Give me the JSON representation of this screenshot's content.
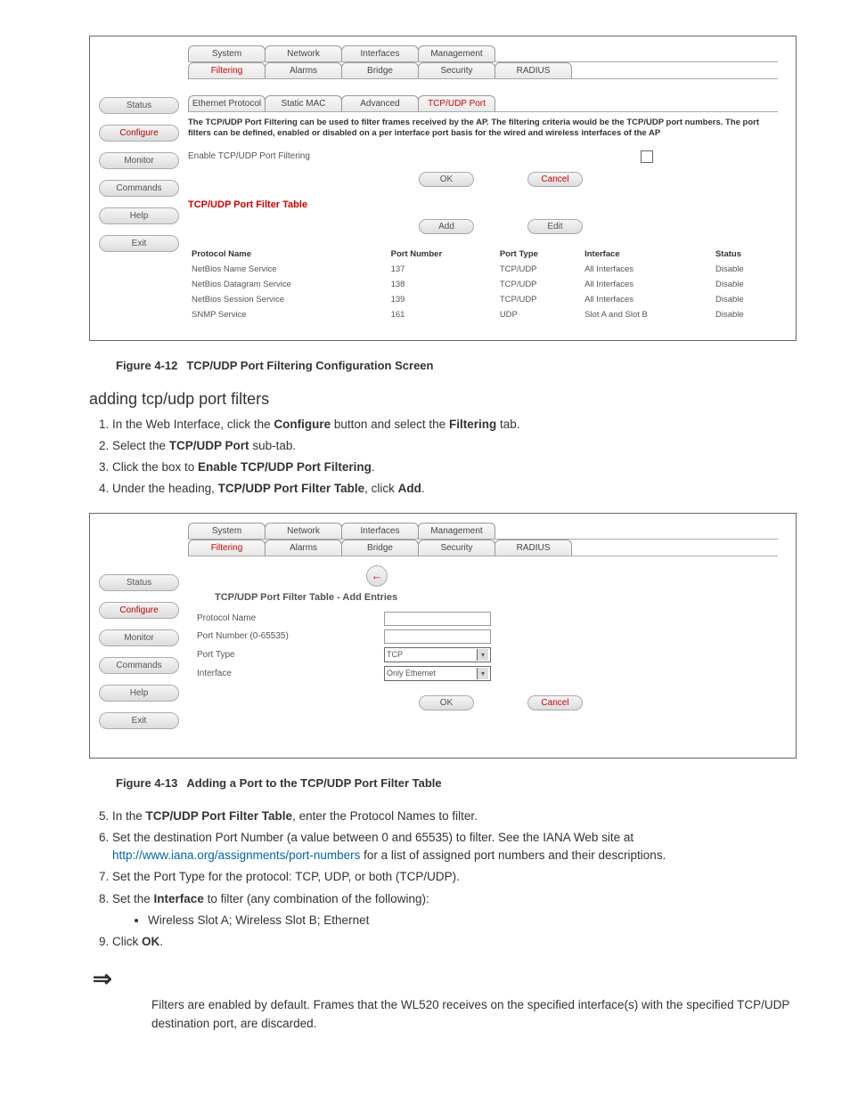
{
  "figure1": {
    "topTabs": [
      "System",
      "Network",
      "Interfaces",
      "Management"
    ],
    "subTabs": [
      "Filtering",
      "Alarms",
      "Bridge",
      "Security",
      "RADIUS"
    ],
    "subActive": 0,
    "innerTabs": [
      "Ethernet Protocol",
      "Static MAC",
      "Advanced",
      "TCP/UDP Port"
    ],
    "innerActive": 3,
    "sidebar": [
      "Status",
      "Configure",
      "Monitor",
      "Commands",
      "Help",
      "Exit"
    ],
    "sidebarActive": 1,
    "description": "The TCP/UDP Port Filtering can be used to filter frames received by the AP. The filtering criteria would be the TCP/UDP port numbers. The port filters can be defined, enabled or disabled on a per interface port basis for the wired and wireless interfaces of the AP",
    "enableLabel": "Enable TCP/UDP Port Filtering",
    "buttons": {
      "ok": "OK",
      "cancel": "Cancel",
      "add": "Add",
      "edit": "Edit"
    },
    "tableTitle": "TCP/UDP Port Filter Table",
    "tableHeaders": [
      "Protocol Name",
      "Port Number",
      "Port Type",
      "Interface",
      "Status"
    ],
    "tableRows": [
      [
        "NetBios Name Service",
        "137",
        "TCP/UDP",
        "All Interfaces",
        "Disable"
      ],
      [
        "NetBios Datagram Service",
        "138",
        "TCP/UDP",
        "All Interfaces",
        "Disable"
      ],
      [
        "NetBios Session Service",
        "139",
        "TCP/UDP",
        "All Interfaces",
        "Disable"
      ],
      [
        "SNMP Service",
        "161",
        "UDP",
        "Slot A and Slot B",
        "Disable"
      ]
    ]
  },
  "caption1": {
    "num": "Figure 4-12",
    "text": "TCP/UDP Port Filtering Configuration Screen"
  },
  "section": {
    "title": "adding tcp/udp port filters",
    "steps_a": [
      {
        "pre": "In the Web Interface, click the ",
        "b1": "Configure",
        "mid": " button and select the ",
        "b2": "Filtering",
        "post": " tab."
      },
      {
        "pre": "Select the ",
        "b1": "TCP/UDP Port",
        "post": " sub-tab."
      },
      {
        "pre": "Click the box to ",
        "b1": "Enable TCP/UDP Port Filtering",
        "post": "."
      },
      {
        "pre": "Under the heading, ",
        "b1": "TCP/UDP Port Filter Table",
        "mid": ", click ",
        "b2": "Add",
        "post": "."
      }
    ]
  },
  "figure2": {
    "topTabs": [
      "System",
      "Network",
      "Interfaces",
      "Management"
    ],
    "subTabs": [
      "Filtering",
      "Alarms",
      "Bridge",
      "Security",
      "RADIUS"
    ],
    "subActive": 0,
    "sidebar": [
      "Status",
      "Configure",
      "Monitor",
      "Commands",
      "Help",
      "Exit"
    ],
    "sidebarActive": 1,
    "backIcon": "←",
    "formTitle": "TCP/UDP Port Filter Table - Add Entries",
    "fields": {
      "protocolName": "Protocol Name",
      "portNumber": "Port Number (0-65535)",
      "portType": "Port Type",
      "interface": "Interface"
    },
    "selects": {
      "portType": "TCP",
      "interface": "Only Ethernet"
    },
    "buttons": {
      "ok": "OK",
      "cancel": "Cancel"
    }
  },
  "caption2": {
    "num": "Figure 4-13",
    "text": "Adding a Port to the TCP/UDP Port Filter Table"
  },
  "steps_b": {
    "s5": {
      "pre": "In the ",
      "b1": "TCP/UDP Port Filter Table",
      "post": ", enter the Protocol Names to filter."
    },
    "s6": {
      "text1": "Set the destination Port Number (a value between 0 and 65535) to filter. See the IANA Web site at ",
      "linkText": "http://www.iana.org/assignments/port-numbers",
      "text2": " for a list of assigned port numbers and their descriptions."
    },
    "s7": "Set the Port Type for the protocol: TCP, UDP, or both (TCP/UDP).",
    "s8": {
      "pre": "Set the ",
      "b1": "Interface",
      "post": " to filter (any combination of the following):"
    },
    "bullet": "Wireless Slot A; Wireless Slot B; Ethernet",
    "s9": {
      "pre": "Click ",
      "b1": "OK",
      "post": "."
    }
  },
  "note": "Filters are enabled by default. Frames that the WL520 receives on the specified interface(s) with the specified TCP/UDP destination port, are discarded."
}
